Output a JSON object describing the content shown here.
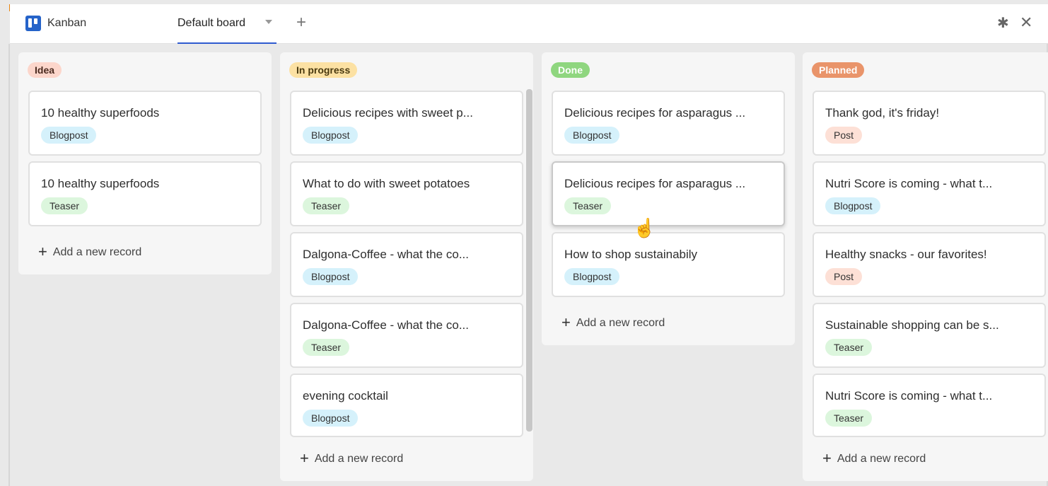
{
  "app": {
    "name": "Kanban",
    "icon": "kanban-board-icon"
  },
  "tabs": [
    {
      "label": "Default board"
    }
  ],
  "toolbar": {
    "add_tab_icon": "+",
    "settings_icon": "✱",
    "close_icon": "✕"
  },
  "columns": [
    {
      "label": "Idea",
      "badge_bg": "#fcd6cb",
      "badge_fg": "#4a2a1f",
      "cards": [
        {
          "title": "10 healthy superfoods",
          "tag": "Blogpost"
        },
        {
          "title": "10 healthy superfoods",
          "tag": "Teaser"
        }
      ],
      "add_label": "Add a new record"
    },
    {
      "label": "In progress",
      "badge_bg": "#fce1a3",
      "badge_fg": "#4a3a10",
      "cards": [
        {
          "title": "Delicious recipes with sweet p...",
          "tag": "Blogpost"
        },
        {
          "title": "What to do with sweet potatoes",
          "tag": "Teaser"
        },
        {
          "title": "Dalgona-Coffee - what the co...",
          "tag": "Blogpost"
        },
        {
          "title": "Dalgona-Coffee - what the co...",
          "tag": "Teaser"
        },
        {
          "title": "evening cocktail",
          "tag": "Blogpost"
        }
      ],
      "add_label": "Add a new record"
    },
    {
      "label": "Done",
      "badge_bg": "#8fd67f",
      "badge_fg": "#ffffff",
      "cards": [
        {
          "title": "Delicious recipes for asparagus ...",
          "tag": "Blogpost"
        },
        {
          "title": "Delicious recipes for asparagus ...",
          "tag": "Teaser"
        },
        {
          "title": "How to shop sustainabily",
          "tag": "Blogpost"
        }
      ],
      "add_label": "Add a new record"
    },
    {
      "label": "Planned",
      "badge_bg": "#e9946a",
      "badge_fg": "#ffffff",
      "cards": [
        {
          "title": "Thank god, it's friday!",
          "tag": "Post"
        },
        {
          "title": "Nutri Score is coming - what t...",
          "tag": "Blogpost"
        },
        {
          "title": "Healthy snacks - our favorites!",
          "tag": "Post"
        },
        {
          "title": "Sustainable shopping can be s...",
          "tag": "Teaser"
        },
        {
          "title": "Nutri Score is coming - what t...",
          "tag": "Teaser"
        }
      ],
      "add_label": "Add a new record"
    }
  ]
}
